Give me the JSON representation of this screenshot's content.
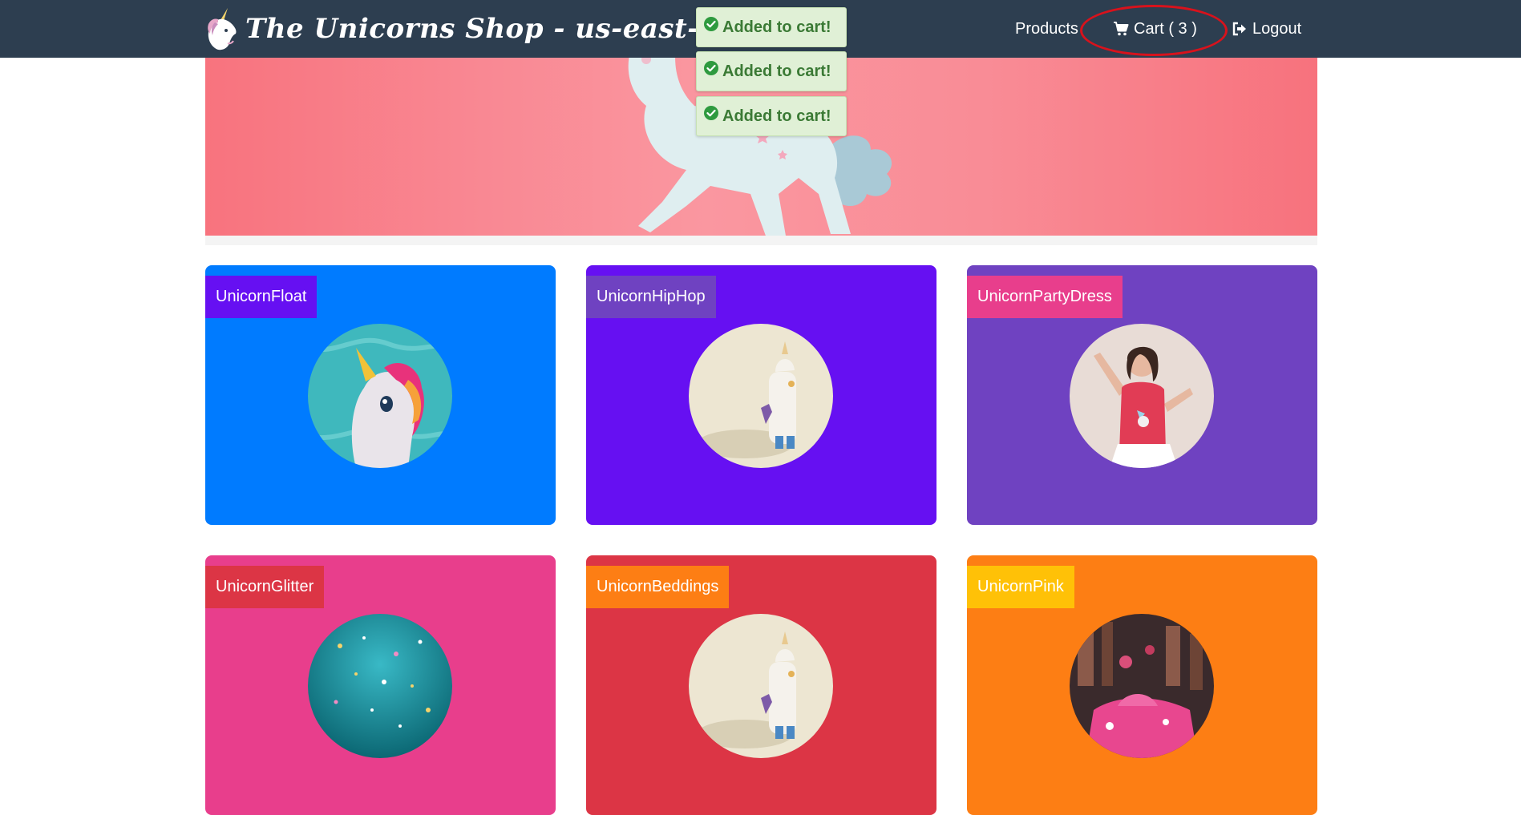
{
  "app": {
    "title": "The Unicorns Shop - us-east-1"
  },
  "nav": {
    "products_label": "Products",
    "cart_label": "Cart ( 3 )",
    "logout_label": "Logout"
  },
  "toasts": [
    {
      "text": "Added to cart!"
    },
    {
      "text": "Added to cart!"
    },
    {
      "text": "Added to cart!"
    }
  ],
  "colors": {
    "navbar": "#2d3e50",
    "highlight": "#d8121c",
    "toast_bg": "#e0f0d6",
    "toast_text": "#3b7a35"
  },
  "products": [
    {
      "name": "UnicornFloat",
      "card_color": "#007bff",
      "label_color": "#6610f2",
      "image": "inflatable-unicorn-pool"
    },
    {
      "name": "UnicornHipHop",
      "card_color": "#6610f2",
      "label_color": "#6f42c1",
      "image": "unicorn-figurine"
    },
    {
      "name": "UnicornPartyDress",
      "card_color": "#6f42c1",
      "label_color": "#e83e8c",
      "image": "girl-unicorn-shirt"
    },
    {
      "name": "UnicornGlitter",
      "card_color": "#e83e8c",
      "label_color": "#dc3545",
      "image": "teal-glitter"
    },
    {
      "name": "UnicornBeddings",
      "card_color": "#dc3545",
      "label_color": "#fd7e14",
      "image": "unicorn-figurine"
    },
    {
      "name": "UnicornPink",
      "card_color": "#fd7e14",
      "label_color": "#ffc107",
      "image": "pink-market"
    }
  ]
}
